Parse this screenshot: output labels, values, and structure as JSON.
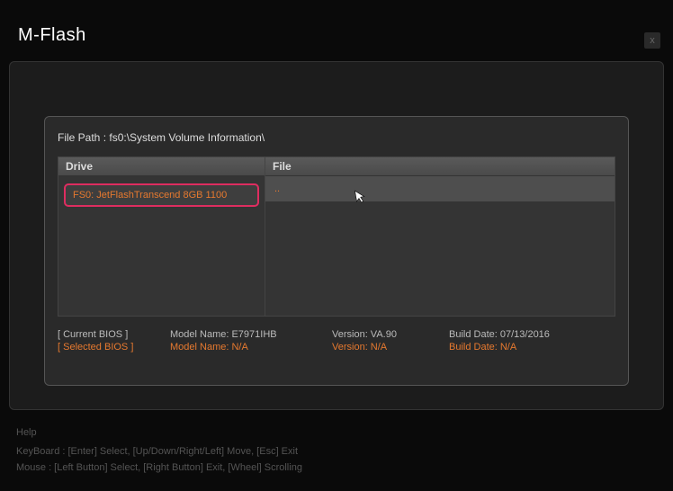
{
  "title": "M-Flash",
  "close": "x",
  "path": {
    "label": "File Path :",
    "value": " fs0:\\System Volume Information\\"
  },
  "headers": {
    "drive": "Drive",
    "file": "File"
  },
  "drive": {
    "entry": "FS0: JetFlashTranscend 8GB 1100"
  },
  "file": {
    "entry": ".."
  },
  "bios": {
    "current": {
      "tag": "[ Current BIOS  ]",
      "model": "Model Name: E7971IHB",
      "version": "Version: VA.90",
      "build": "Build Date: 07/13/2016"
    },
    "selected": {
      "tag": "[ Selected BIOS ]",
      "model": "Model Name: N/A",
      "version": "Version: N/A",
      "build": "Build Date: N/A"
    }
  },
  "help": {
    "title": "Help",
    "keyboard": "KeyBoard :   [Enter]  Select,    [Up/Down/Right/Left]  Move,   [Esc]  Exit",
    "mouse": "Mouse     :   [Left Button]  Select,   [Right Button]  Exit,   [Wheel]  Scrolling"
  }
}
